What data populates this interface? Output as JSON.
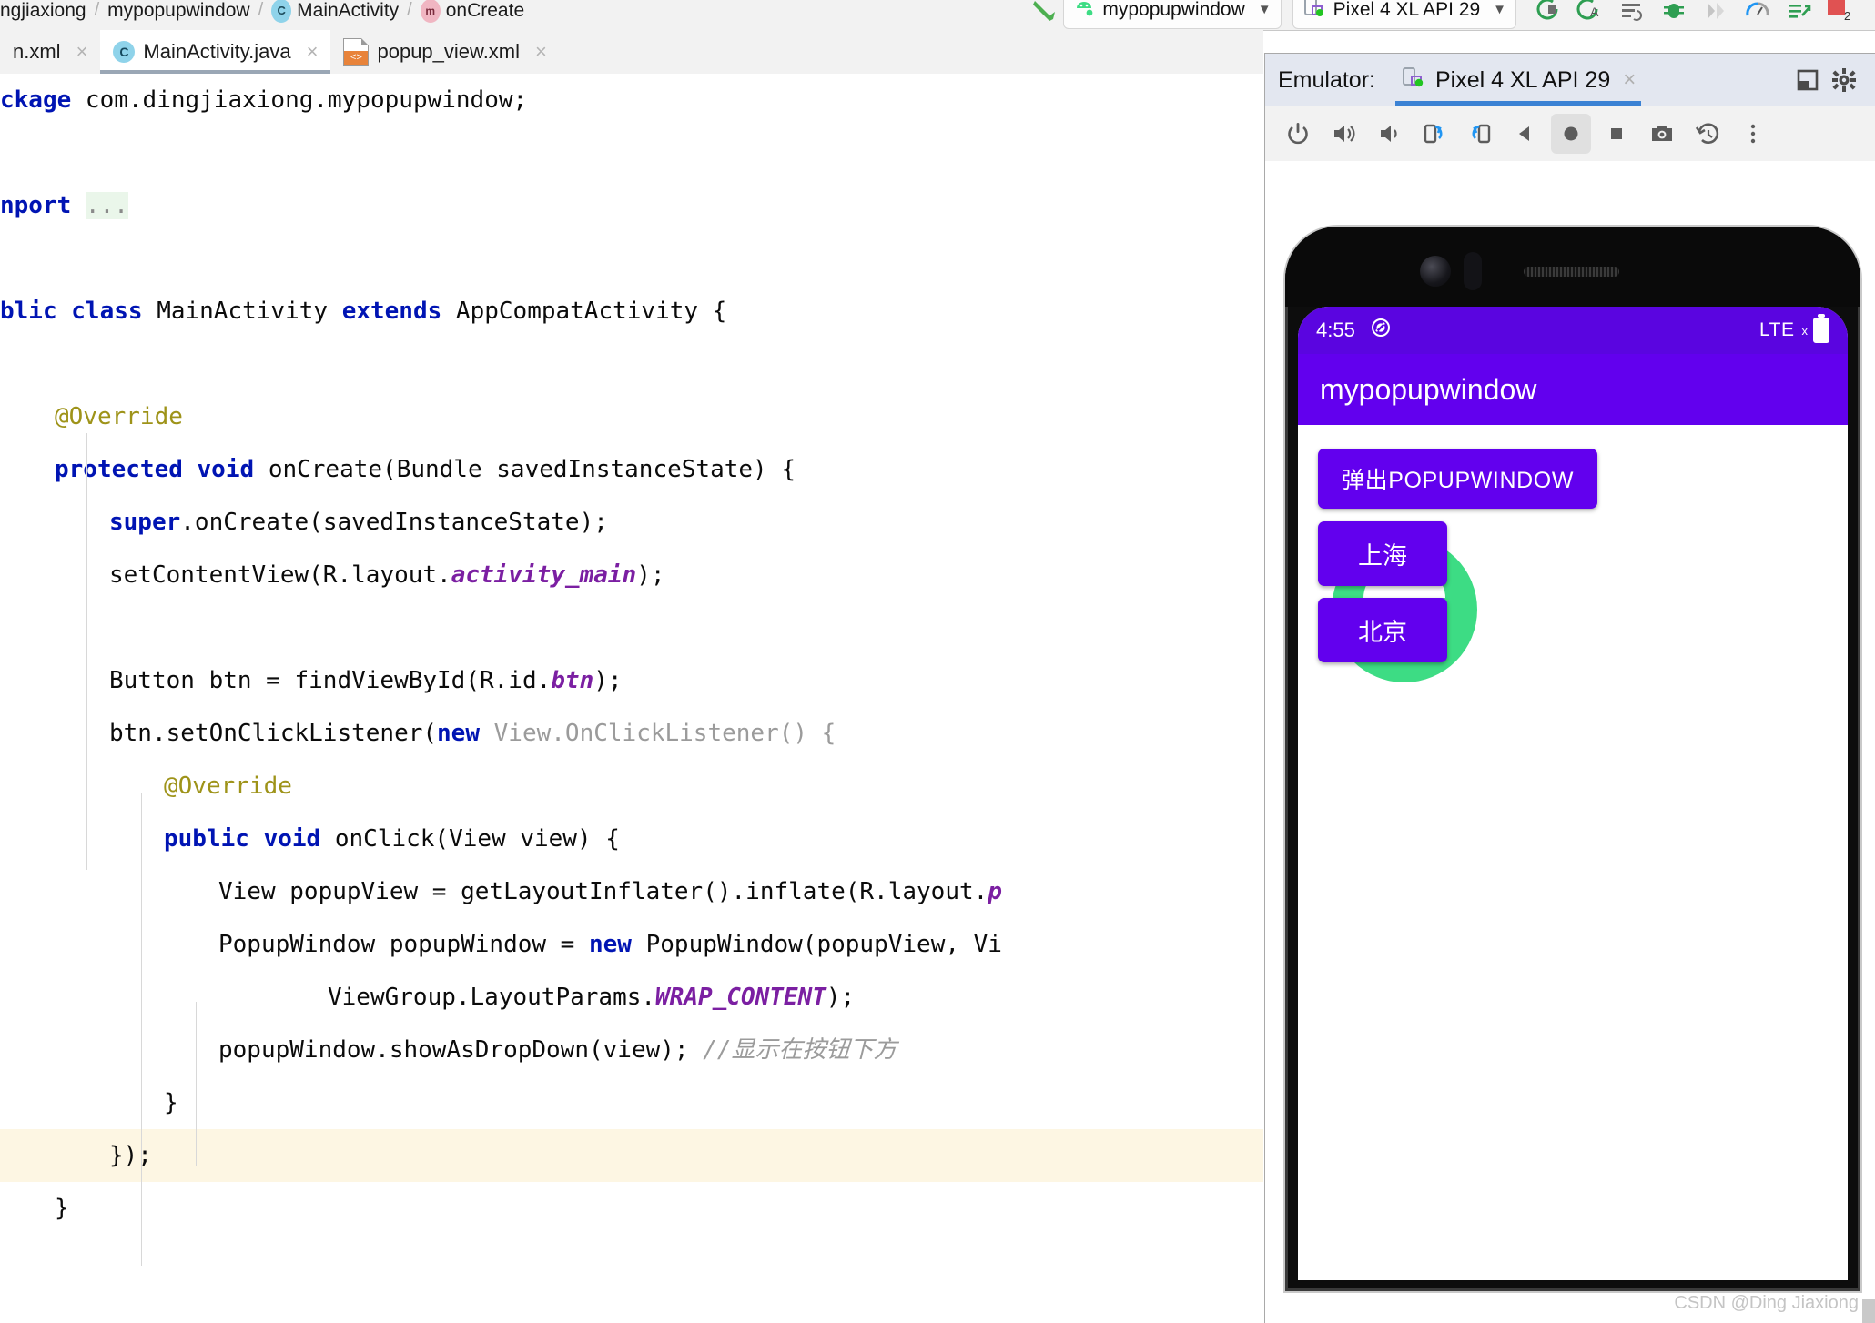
{
  "breadcrumb": {
    "items": [
      {
        "label": "ngjiaxiong",
        "icon": ""
      },
      {
        "label": "mypopupwindow",
        "icon": ""
      },
      {
        "label": "MainActivity",
        "icon": "class-icon"
      },
      {
        "label": "onCreate",
        "icon": "method-icon"
      }
    ],
    "separator": "/"
  },
  "toolbar": {
    "run_config": {
      "label": "mypopupwindow",
      "icon": "android-icon",
      "caret": "▼"
    },
    "device": {
      "label": "Pixel 4 XL API 29",
      "icon": "device-icon",
      "caret": "▼"
    },
    "icons": [
      "run-icon",
      "run-with-coverage-icon",
      "profile-icon",
      "debug-icon",
      "step-icon",
      "memory-icon",
      "attach-debugger-icon",
      "problems-icon"
    ],
    "problems_count": "2"
  },
  "editor_tabs": [
    {
      "label": "n.xml",
      "icon": "xml-file-icon",
      "active": false,
      "close": "×"
    },
    {
      "label": "MainActivity.java",
      "icon": "java-class-icon",
      "active": true,
      "close": "×"
    },
    {
      "label": "popup_view.xml",
      "icon": "layout-xml-icon",
      "active": false,
      "close": "×"
    }
  ],
  "code": {
    "language": "java",
    "lines": [
      {
        "id": "l1",
        "indent": 0,
        "highlight": false,
        "tokens": [
          {
            "t": "ckage ",
            "c": "kw"
          },
          {
            "t": "com.dingjiaxiong.mypopupwindow;",
            "c": ""
          }
        ]
      },
      {
        "id": "l2",
        "indent": 0,
        "highlight": false,
        "tokens": []
      },
      {
        "id": "l3",
        "indent": 0,
        "highlight": false,
        "tokens": [
          {
            "t": "nport ",
            "c": "kw"
          },
          {
            "t": "...",
            "c": "fold"
          }
        ]
      },
      {
        "id": "l4",
        "indent": 0,
        "highlight": false,
        "tokens": []
      },
      {
        "id": "l5",
        "indent": 0,
        "highlight": false,
        "tokens": [
          {
            "t": "blic class ",
            "c": "kw"
          },
          {
            "t": "MainActivity ",
            "c": ""
          },
          {
            "t": "extends ",
            "c": "kw"
          },
          {
            "t": "AppCompatActivity {",
            "c": ""
          }
        ]
      },
      {
        "id": "l6",
        "indent": 0,
        "highlight": false,
        "tokens": []
      },
      {
        "id": "l7",
        "indent": 1,
        "highlight": false,
        "tokens": [
          {
            "t": "@Override",
            "c": "anno"
          }
        ]
      },
      {
        "id": "l8",
        "indent": 1,
        "highlight": false,
        "tokens": [
          {
            "t": "protected void ",
            "c": "kw"
          },
          {
            "t": "onCreate(Bundle savedInstanceState) {",
            "c": ""
          }
        ]
      },
      {
        "id": "l9",
        "indent": 2,
        "highlight": false,
        "tokens": [
          {
            "t": "super",
            "c": "kw"
          },
          {
            "t": ".onCreate(savedInstanceState);",
            "c": ""
          }
        ]
      },
      {
        "id": "l10",
        "indent": 2,
        "highlight": false,
        "tokens": [
          {
            "t": "setContentView(R.layout.",
            "c": ""
          },
          {
            "t": "activity_main",
            "c": "const"
          },
          {
            "t": ");",
            "c": ""
          }
        ]
      },
      {
        "id": "l11",
        "indent": 0,
        "highlight": false,
        "tokens": []
      },
      {
        "id": "l12",
        "indent": 2,
        "highlight": false,
        "tokens": [
          {
            "t": "Button btn = findViewById(R.id.",
            "c": ""
          },
          {
            "t": "btn",
            "c": "const"
          },
          {
            "t": ");",
            "c": ""
          }
        ]
      },
      {
        "id": "l13",
        "indent": 2,
        "highlight": false,
        "tokens": [
          {
            "t": "btn.setOnClickListener(",
            "c": ""
          },
          {
            "t": "new ",
            "c": "kw"
          },
          {
            "t": "View.OnClickListener() {",
            "c": "dim"
          }
        ]
      },
      {
        "id": "l14",
        "indent": 3,
        "highlight": false,
        "tokens": [
          {
            "t": "@Override",
            "c": "anno"
          }
        ]
      },
      {
        "id": "l15",
        "indent": 3,
        "highlight": false,
        "tokens": [
          {
            "t": "public void ",
            "c": "kw"
          },
          {
            "t": "onClick(View view) {",
            "c": ""
          }
        ]
      },
      {
        "id": "l16",
        "indent": 4,
        "highlight": false,
        "tokens": [
          {
            "t": "View popupView = getLayoutInflater().inflate(R.layout.",
            "c": ""
          },
          {
            "t": "p",
            "c": "const"
          }
        ]
      },
      {
        "id": "l17",
        "indent": 4,
        "highlight": false,
        "tokens": [
          {
            "t": "PopupWindow popupWindow = ",
            "c": ""
          },
          {
            "t": "new ",
            "c": "kw"
          },
          {
            "t": "PopupWindow(popupView, Vi",
            "c": ""
          }
        ]
      },
      {
        "id": "l18",
        "indent": 6,
        "highlight": false,
        "tokens": [
          {
            "t": "ViewGroup.LayoutParams.",
            "c": ""
          },
          {
            "t": "WRAP_CONTENT",
            "c": "const"
          },
          {
            "t": ");",
            "c": ""
          }
        ]
      },
      {
        "id": "l19",
        "indent": 4,
        "highlight": false,
        "tokens": [
          {
            "t": "popupWindow.showAsDropDown(view); ",
            "c": ""
          },
          {
            "t": "//显示在按钮下方",
            "c": "cmt"
          }
        ]
      },
      {
        "id": "l20",
        "indent": 3,
        "highlight": false,
        "tokens": [
          {
            "t": "}",
            "c": ""
          }
        ]
      },
      {
        "id": "l21",
        "indent": 2,
        "highlight": true,
        "tokens": [
          {
            "t": "});",
            "c": ""
          }
        ]
      },
      {
        "id": "l22",
        "indent": 1,
        "highlight": false,
        "tokens": [
          {
            "t": "}",
            "c": ""
          }
        ]
      }
    ]
  },
  "emulator": {
    "panel_label": "Emulator:",
    "tab": {
      "label": "Pixel 4 XL API 29",
      "icon": "device-icon",
      "close": "×"
    },
    "header_icons": [
      "minimize-window-icon",
      "gear-icon"
    ],
    "toolbar_icons": [
      "power-icon",
      "volume-up-icon",
      "volume-down-icon",
      "rotate-left-icon",
      "rotate-right-icon",
      "back-icon",
      "home-icon",
      "overview-icon",
      "screenshot-icon",
      "history-icon",
      "more-icon"
    ],
    "selected_tool": "home-icon"
  },
  "device_screen": {
    "status_bar": {
      "time": "4:55",
      "dnd_icon": "do-not-disturb-icon",
      "network": "LTE",
      "network_sub": "x",
      "battery_icon": "battery-full-icon"
    },
    "app_bar": {
      "title": "mypopupwindow"
    },
    "main_button": {
      "label": "弹出POPUPWINDOW"
    },
    "popup": {
      "items": [
        {
          "label": "上海"
        },
        {
          "label": "北京"
        }
      ]
    },
    "background_icon": "android-robot-icon"
  },
  "watermark": {
    "text": "CSDN @Ding Jiaxiong"
  },
  "colors": {
    "accent_purple": "#6200ee",
    "status_purple": "#5a05e0",
    "keyword_blue": "#0014b3",
    "const_purple": "#7b1fa2",
    "annotation_olive": "#9e9319",
    "tab_underline": "#3b82d4",
    "android_green": "#3ddc84",
    "highlight_line": "#fdf6e3"
  }
}
